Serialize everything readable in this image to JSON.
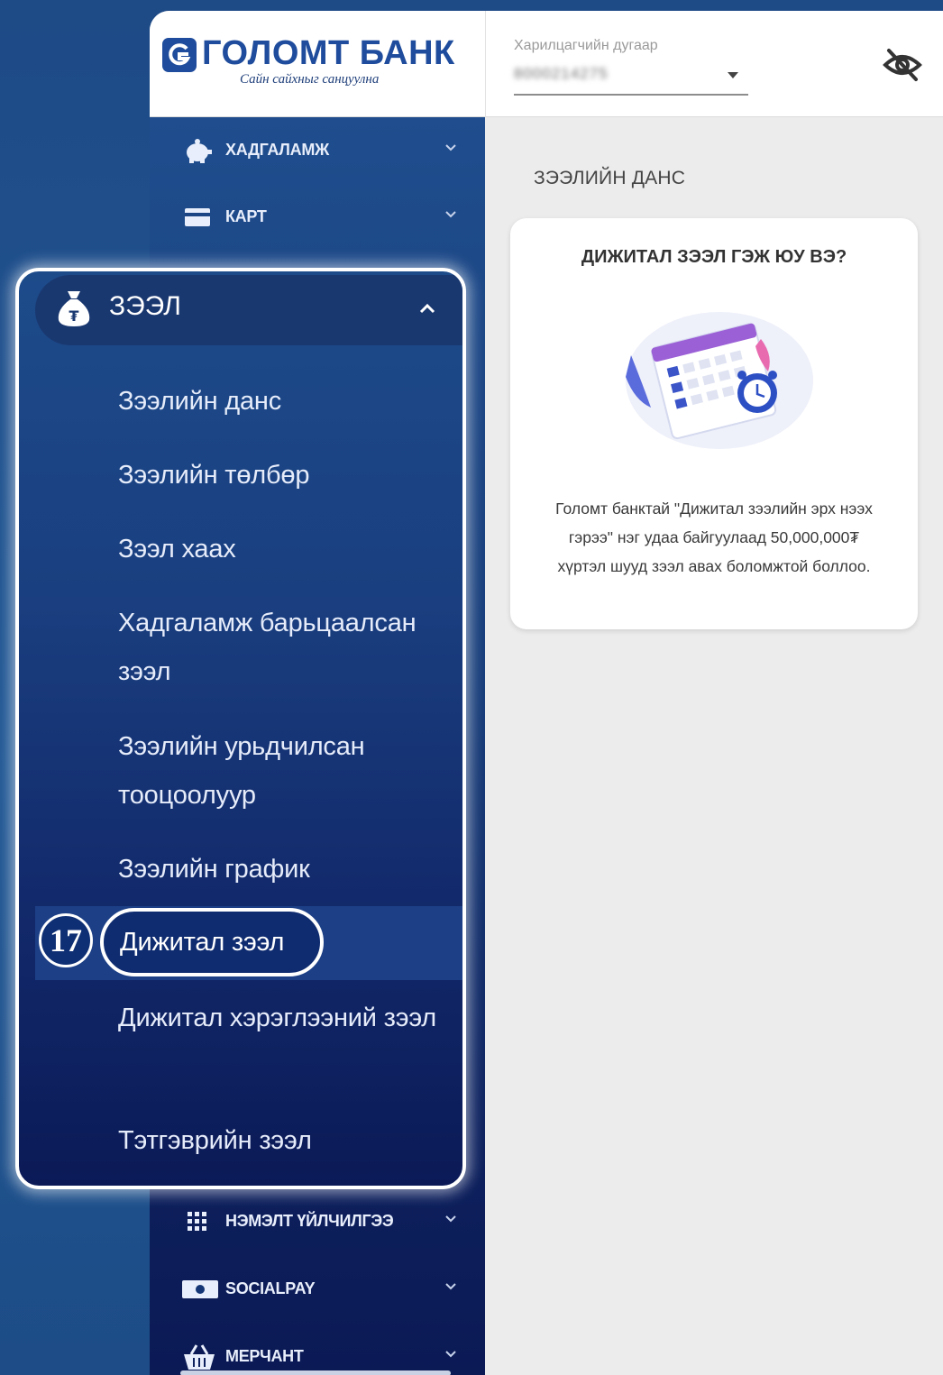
{
  "header": {
    "bank_name": "ГОЛОМТ БАНК",
    "slogan": "Сайн сайхныг санцуулна",
    "customer_label": "Харилцагчийн дугаар",
    "customer_value": "8000214275"
  },
  "sidebar": {
    "items": [
      {
        "label": "ХАДГАЛАМЖ",
        "icon": "piggy-bank-icon"
      },
      {
        "label": "КАРТ",
        "icon": "card-icon"
      },
      {
        "label": "НЭМЭЛТ ҮЙЛЧИЛГЭЭ",
        "icon": "grid-icon"
      },
      {
        "label": "SOCIALPAY",
        "icon": "cash-icon"
      },
      {
        "label": "МЕРЧАНТ",
        "icon": "basket-icon"
      }
    ]
  },
  "loans_menu": {
    "title": "ЗЭЭЛ",
    "items": [
      "Зээлийн данс",
      "Зээлийн төлбөр",
      "Зээл хаах",
      "Хадгаламж барьцаалсан зээл",
      "Зээлийн урьдчилсан тооцоолуур",
      "Зээлийн график",
      "Дижитал зээл",
      "Дижитал хэрэглээний зээл",
      "Тэтгэврийн зээл"
    ],
    "active_index": 6,
    "step_number": "17"
  },
  "main": {
    "title": "ЗЭЭЛИЙН ДАНС",
    "card_title": "ДИЖИТАЛ ЗЭЭЛ ГЭЖ ЮУ ВЭ?",
    "card_text": "Голомт банктай \"Дижитал зээлийн эрх нээх гэрээ\" нэг удаа байгуулаад 50,000,000₮ хүртэл шууд зээл авах боломжтой боллоо."
  },
  "colors": {
    "brand": "#1f4c9c",
    "sidebar_top": "#1f4d8d",
    "sidebar_bottom": "#0b1a55",
    "content_bg": "#ececec"
  }
}
